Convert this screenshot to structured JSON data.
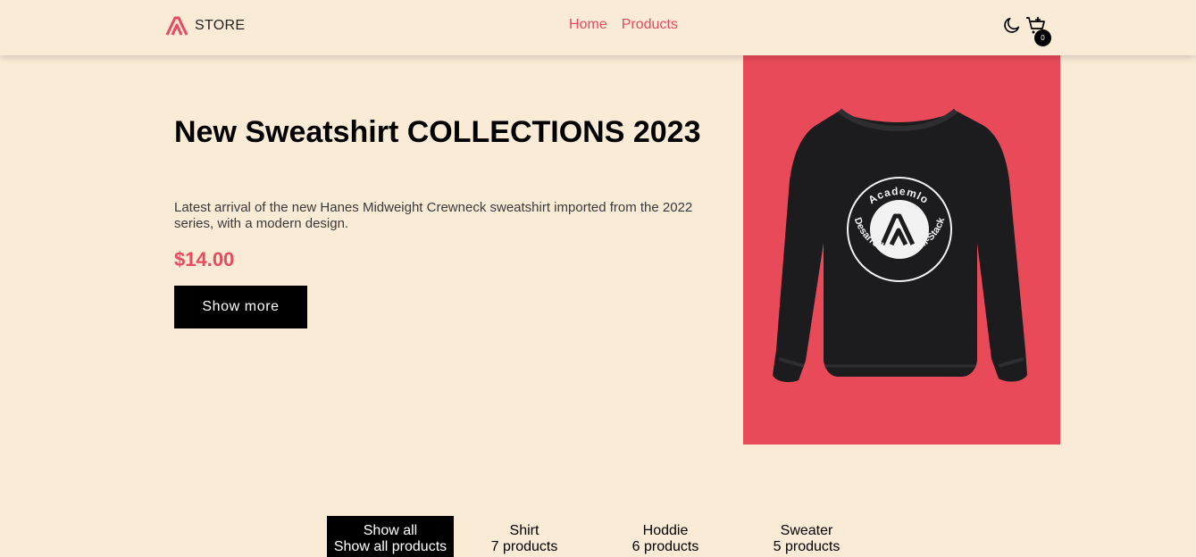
{
  "header": {
    "logo_text": "STORE",
    "nav": [
      "Home",
      "Products"
    ],
    "cart_count": "0",
    "accent": "#e84a5f"
  },
  "hero": {
    "title": "New Sweatshirt COLLECTIONS 2023",
    "description": "Latest arrival of the new Hanes Midweight Crewneck sweatshirt imported from the 2022 series, with a modern design.",
    "price": "$14.00",
    "button": "Show more",
    "image_bg": "#e84a5a",
    "badge_top": "Academlo",
    "badge_bottom": "Desarrollo Web Full-Stack"
  },
  "filters": [
    {
      "name": "Show all",
      "count": "Show all products"
    },
    {
      "name": "Shirt",
      "count": "7 products"
    },
    {
      "name": "Hoddie",
      "count": "6 products"
    },
    {
      "name": "Sweater",
      "count": "5 products"
    }
  ]
}
